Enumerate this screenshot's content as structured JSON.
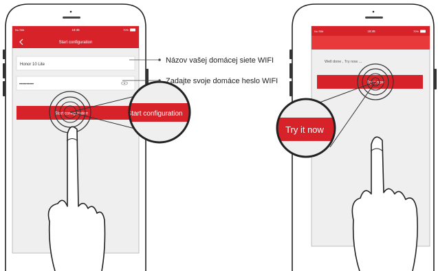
{
  "left_phone": {
    "status_bar": {
      "carrier": "No SIM",
      "time": "18:45",
      "battery": "70%"
    },
    "header": {
      "title": "Start configuration"
    },
    "form": {
      "ssid_value": "Honor 10 Lite",
      "password_value": "••••••••••",
      "submit_label": "Start configuration"
    }
  },
  "annotations": {
    "ssid_label": "Názov vašej domácej siete WIFI",
    "password_label": "Zadajte svoje domáce heslo WIFI"
  },
  "zoom_left": {
    "label": "Start configuration"
  },
  "right_phone": {
    "status_bar": {
      "carrier": "No SIM",
      "time": "18:45",
      "battery": "70%"
    },
    "message": "Well done , Try now ...",
    "button_label": "Try it now"
  },
  "zoom_right": {
    "label": "Try it now"
  },
  "colors": {
    "accent_red": "#d8222a",
    "screen_bg": "#efefef"
  }
}
